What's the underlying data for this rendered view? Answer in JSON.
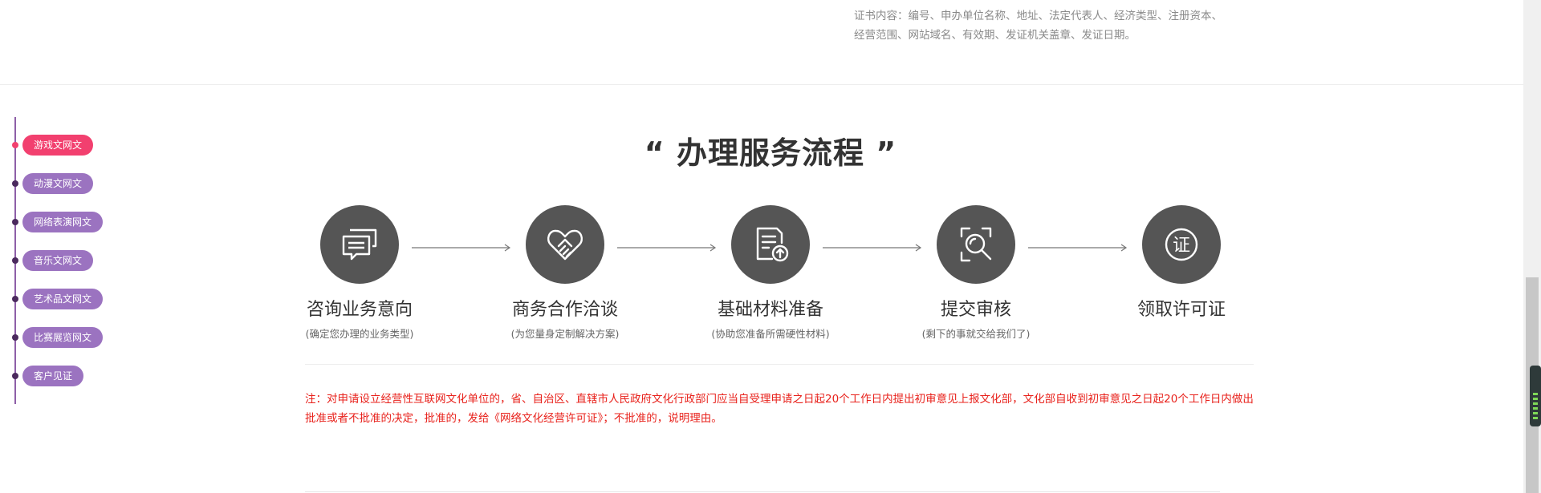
{
  "certificate": {
    "text": "证书内容：编号、申办单位名称、地址、法定代表人、经济类型、注册资本、经营范围、网站域名、有效期、发证机关盖章、发证日期。"
  },
  "sidenav": {
    "items": [
      {
        "label": "游戏文网文",
        "active": true
      },
      {
        "label": "动漫文网文",
        "active": false
      },
      {
        "label": "网络表演网文",
        "active": false
      },
      {
        "label": "音乐文网文",
        "active": false
      },
      {
        "label": "艺术品文网文",
        "active": false
      },
      {
        "label": "比赛展览网文",
        "active": false
      },
      {
        "label": "客户见证",
        "active": false
      }
    ]
  },
  "section": {
    "title": "“ 办理服务流程 ”"
  },
  "steps": [
    {
      "title": "咨询业务意向",
      "subtitle": "(确定您办理的业务类型)",
      "icon": "chat-bubbles-icon"
    },
    {
      "title": "商务合作洽谈",
      "subtitle": "(为您量身定制解决方案)",
      "icon": "handshake-icon"
    },
    {
      "title": "基础材料准备",
      "subtitle": "(协助您准备所需硬性材料)",
      "icon": "document-upload-icon"
    },
    {
      "title": "提交审核",
      "subtitle": "(剩下的事就交给我们了)",
      "icon": "magnifier-icon"
    },
    {
      "title": "领取许可证",
      "subtitle": "",
      "icon": "certificate-seal-icon"
    }
  ],
  "note": {
    "text": "注：对申请设立经营性互联网文化单位的，省、自治区、直辖市人民政府文化行政部门应当自受理申请之日起20个工作日内提出初审意见上报文化部，文化部自收到初审意见之日起20个工作日内做出批准或者不批准的决定，批准的，发给《网络文化经营许可证》；不批准的，说明理由。"
  },
  "colors": {
    "nav_active": "#f2406f",
    "nav_inactive": "#9b73c0",
    "nav_line": "#8e5fa8",
    "step_circle": "#555555",
    "note_text": "#e8211b"
  }
}
